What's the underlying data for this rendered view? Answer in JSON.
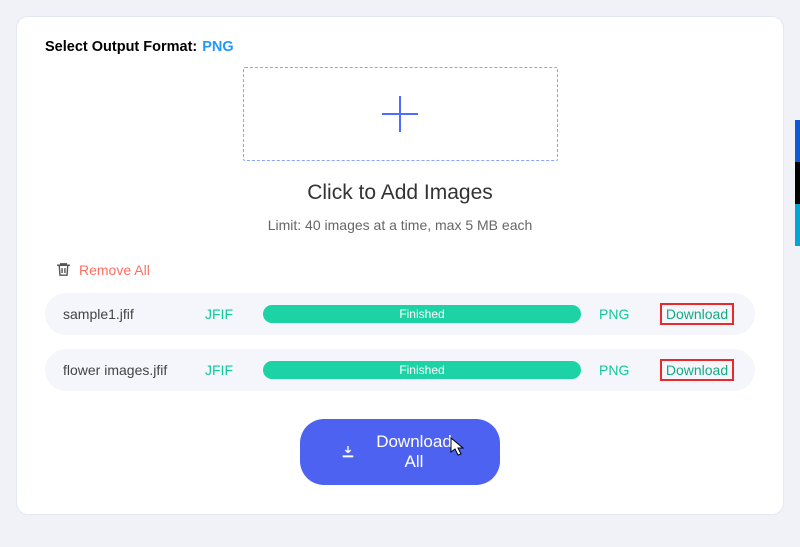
{
  "header": {
    "label": "Select Output Format:",
    "value": "PNG"
  },
  "dropzone": {
    "title": "Click to Add Images",
    "limit_text": "Limit: 40 images at a time, max 5 MB each"
  },
  "toolbar": {
    "remove_all": "Remove All",
    "download_all": "Download All"
  },
  "files": [
    {
      "name": "sample1.jfif",
      "src_fmt": "JFIF",
      "status": "Finished",
      "dst_fmt": "PNG",
      "action": "Download"
    },
    {
      "name": "flower images.jfif",
      "src_fmt": "JFIF",
      "status": "Finished",
      "dst_fmt": "PNG",
      "action": "Download"
    }
  ]
}
